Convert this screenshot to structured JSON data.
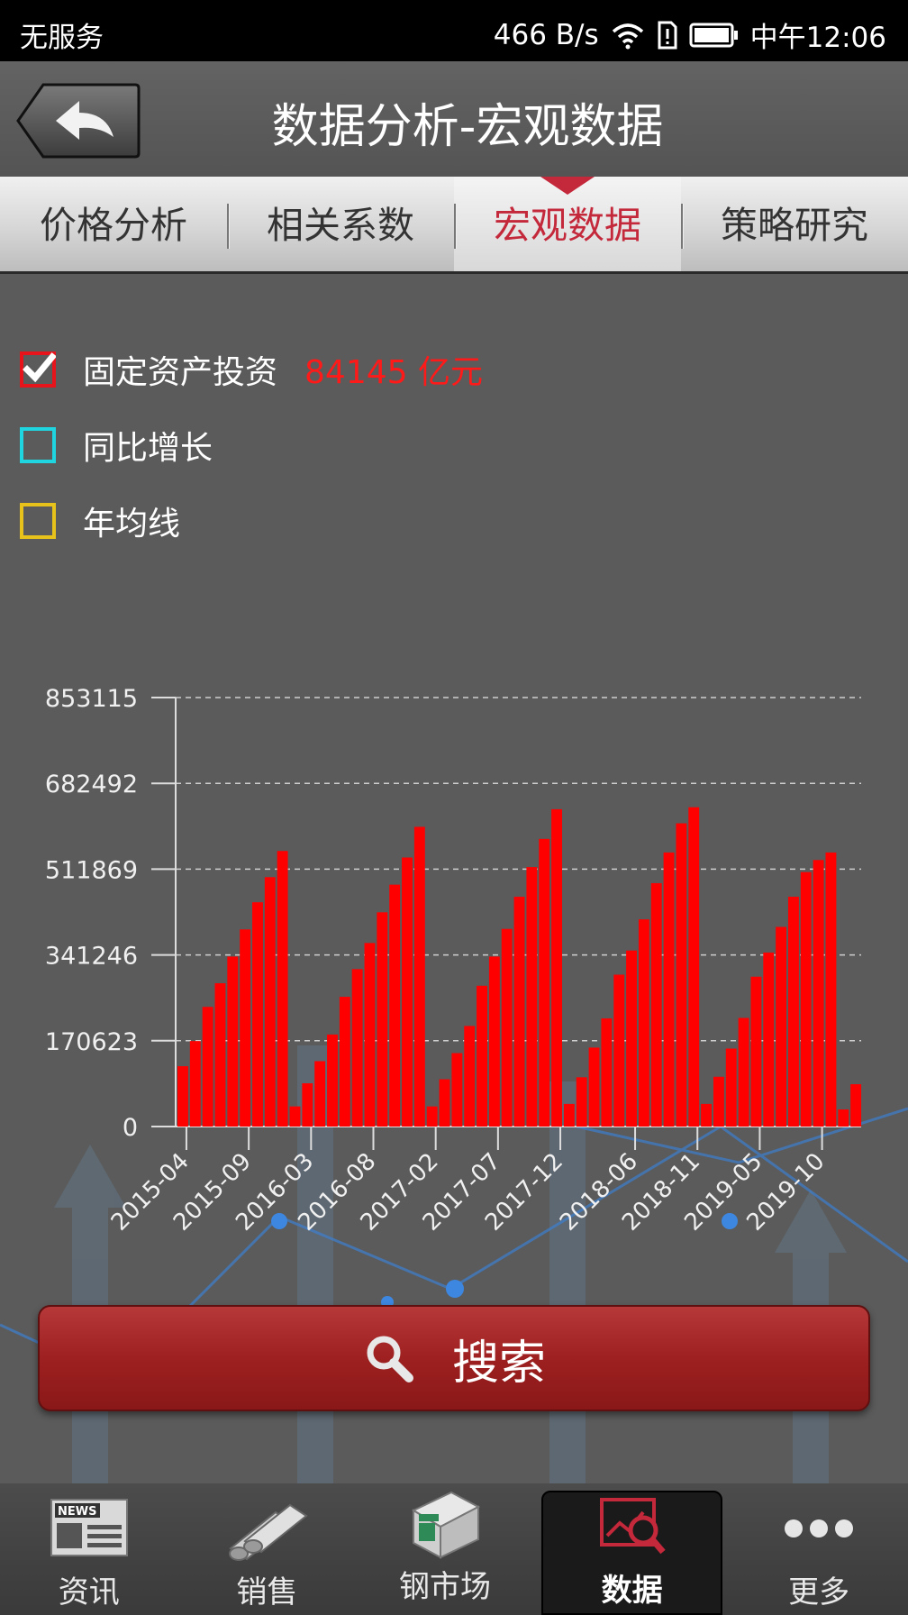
{
  "status_bar": {
    "carrier": "无服务",
    "net_speed": "466 B/s",
    "time": "中午12:06"
  },
  "header": {
    "title": "数据分析-宏观数据",
    "back_icon": "back-arrow-icon"
  },
  "tabs": [
    {
      "label": "价格分析",
      "active": false
    },
    {
      "label": "相关系数",
      "active": false
    },
    {
      "label": "宏观数据",
      "active": true
    },
    {
      "label": "策略研究",
      "active": false
    }
  ],
  "legend": [
    {
      "label": "固定资产投资",
      "value": "84145 亿元",
      "checked": true,
      "color": "#e8141b"
    },
    {
      "label": "同比增长",
      "value": "",
      "checked": false,
      "color": "#1fd6e0"
    },
    {
      "label": "年均线",
      "value": "",
      "checked": false,
      "color": "#e6c21a"
    }
  ],
  "chart_data": {
    "type": "bar",
    "ylim": [
      0,
      853115
    ],
    "y_ticks": [
      "853115",
      "682492",
      "511869",
      "341246",
      "170623",
      "0"
    ],
    "x_tick_labels": [
      "2015-04",
      "2015-09",
      "2016-03",
      "2016-08",
      "2017-02",
      "2017-07",
      "2017-12",
      "2018-06",
      "2018-11",
      "2019-05",
      "2019-10"
    ],
    "bar_color": "#ff0000",
    "grid": true,
    "values": [
      120000,
      170000,
      238000,
      285000,
      338000,
      392000,
      446000,
      496000,
      548000,
      40000,
      86000,
      130000,
      183000,
      258000,
      313000,
      365000,
      426000,
      481000,
      535000,
      596000,
      40000,
      94000,
      146000,
      200000,
      280000,
      338000,
      393000,
      457000,
      516000,
      572000,
      631000,
      45000,
      98000,
      157000,
      215000,
      302000,
      350000,
      412000,
      484000,
      545000,
      603000,
      635000,
      45000,
      99000,
      155000,
      216000,
      298000,
      346000,
      397000,
      457000,
      506000,
      530000,
      545000,
      34000,
      84145
    ]
  },
  "search_button": {
    "label": "搜索",
    "icon": "search-icon"
  },
  "bottom_nav": [
    {
      "label": "资讯",
      "icon": "news-icon",
      "active": false
    },
    {
      "label": "销售",
      "icon": "steel-pipes-icon",
      "active": false
    },
    {
      "label": "钢市场",
      "icon": "market-store-icon",
      "active": false
    },
    {
      "label": "数据",
      "icon": "data-chart-icon",
      "active": true
    },
    {
      "label": "更多",
      "icon": "more-dots-icon",
      "active": false
    }
  ]
}
